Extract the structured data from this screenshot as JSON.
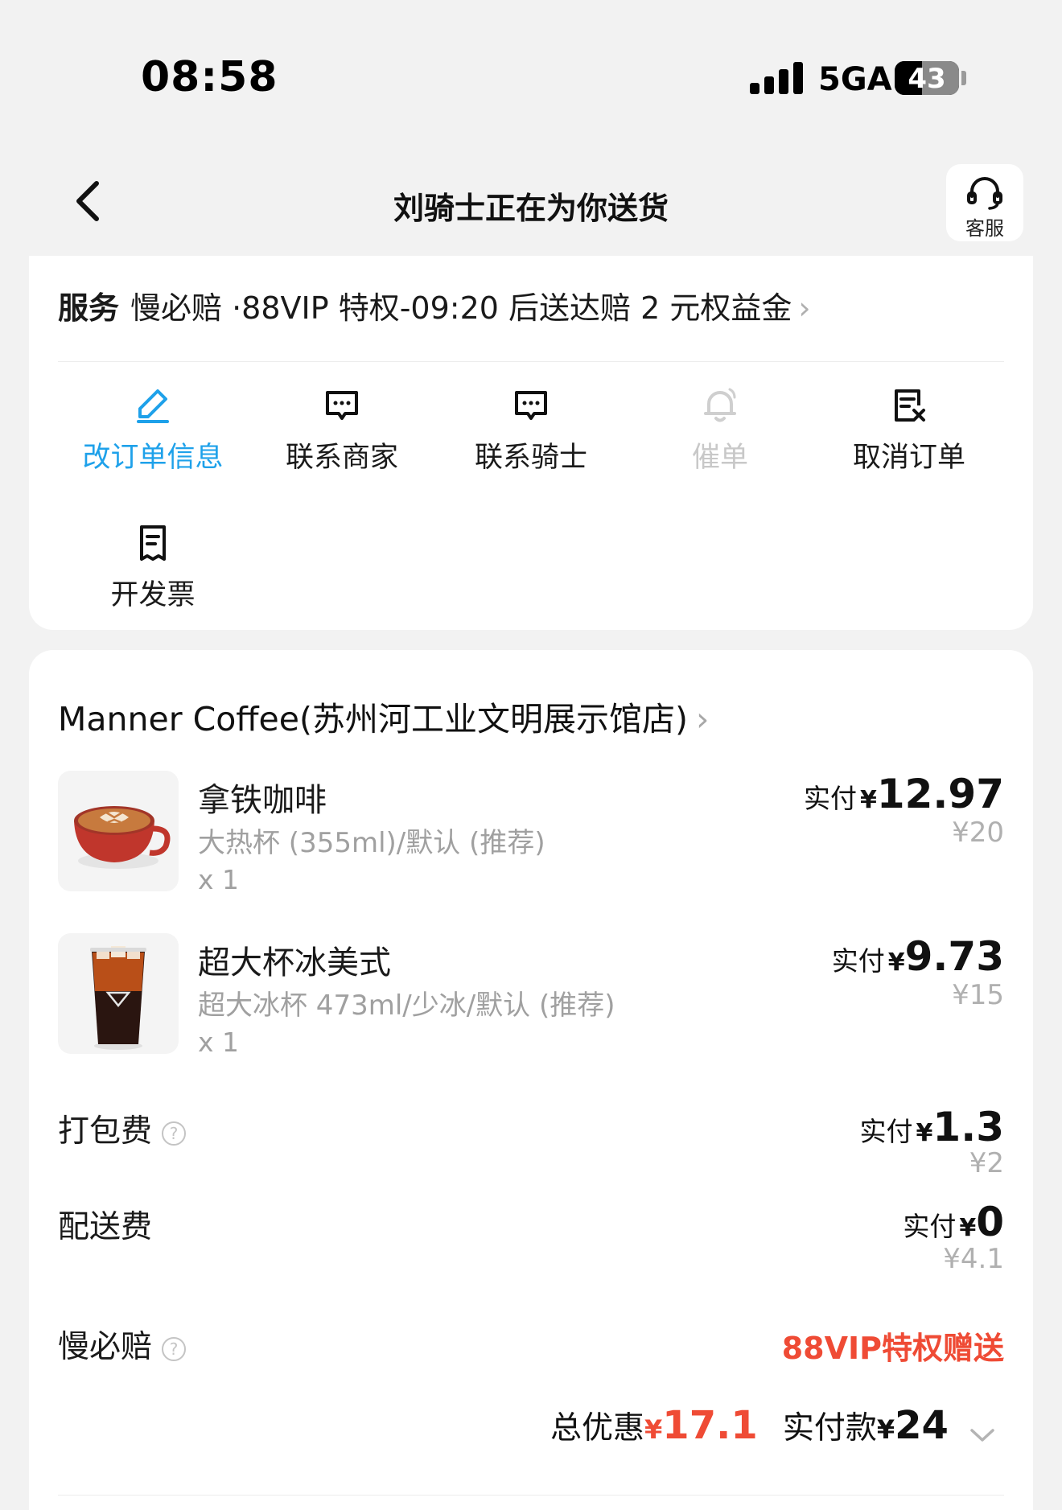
{
  "status_bar": {
    "time": "08:58",
    "network": "5GA",
    "battery": "43",
    "battery_level": 0.43
  },
  "nav": {
    "title": "刘骑士正在为你送货",
    "cs_label": "客服"
  },
  "service": {
    "label": "服务",
    "text": "慢必赔 ·88VIP 特权-09:20 后送达赔 2 元权益金",
    "chevron": "›"
  },
  "actions": [
    {
      "label": "改订单信息",
      "icon": "edit-icon"
    },
    {
      "label": "联系商家",
      "icon": "chat-icon"
    },
    {
      "label": "联系骑士",
      "icon": "chat-icon"
    },
    {
      "label": "催单",
      "icon": "bell-icon"
    },
    {
      "label": "取消订单",
      "icon": "cancel-document-icon"
    },
    {
      "label": "开发票",
      "icon": "receipt-icon"
    }
  ],
  "store": {
    "name": "Manner Coffee(苏州河工业文明展示馆店)",
    "chevron": "›"
  },
  "products": [
    {
      "name": "拿铁咖啡",
      "spec": "大热杯 (355ml)/默认 (推荐)",
      "qty": "x 1",
      "paid_prefix": "实付",
      "yen": "¥",
      "paid": "12.97",
      "original": "¥20"
    },
    {
      "name": "超大杯冰美式",
      "spec": "超大冰杯 473ml/少冰/默认 (推荐)",
      "qty": "x 1",
      "paid_prefix": "实付",
      "yen": "¥",
      "paid": "9.73",
      "original": "¥15"
    }
  ],
  "fees": {
    "packing": {
      "label": "打包费",
      "help": "?",
      "paid_prefix": "实付",
      "yen": "¥",
      "paid": "1.3",
      "original": "¥2"
    },
    "delivery": {
      "label": "配送费",
      "paid_prefix": "实付",
      "yen": "¥",
      "paid": "0",
      "original": "¥4.1"
    },
    "slow_compensation": {
      "label": "慢必赔",
      "help": "?",
      "value": "88VIP特权赠送"
    }
  },
  "totals": {
    "discount_label": "总优惠",
    "yen": "¥",
    "discount": "17.1",
    "paid_label": "实付款",
    "paid": "24"
  },
  "colors": {
    "accent": "#1ea1ea",
    "red": "#ef4b35",
    "muted": "#a0a0a0",
    "disabled": "#c8c8c8"
  }
}
